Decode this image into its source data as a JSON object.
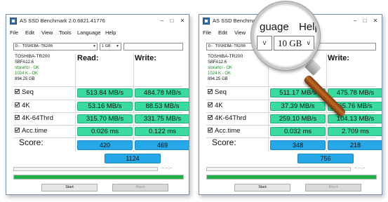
{
  "windows": [
    {
      "title": "AS SSD Benchmark 2.0.6821.41776",
      "menu": [
        "File",
        "Edit",
        "View",
        "Tools",
        "Language",
        "Help"
      ],
      "drive": "D: TOSHIBA-TR200",
      "size": "1 GB",
      "info": {
        "model": "TOSHIBA-TR200",
        "firmware": "SBFA12.6",
        "driver": "storahci - OK",
        "align": "1024 K - OK",
        "capacity": "894.25 GB"
      },
      "headers": {
        "read": "Read:",
        "write": "Write:"
      },
      "rows": [
        {
          "label": "Seq",
          "read": "513.84 MB/s",
          "write": "484.78 MB/s"
        },
        {
          "label": "4K",
          "read": "53.16 MB/s",
          "write": "88.53 MB/s"
        },
        {
          "label": "4K-64Thrd",
          "read": "315.70 MB/s",
          "write": "331.75 MB/s"
        },
        {
          "label": "Acc.time",
          "read": "0.026 ms",
          "write": "0.122 ms"
        }
      ],
      "score_label": "Score:",
      "score": {
        "read": "420",
        "write": "469",
        "total": "1124"
      },
      "time": "--:--:--",
      "progress": 1.0,
      "buttons": {
        "start": "Start",
        "abort": "Abort"
      }
    },
    {
      "title": "AS SSD Benchmark",
      "menu": [
        "File",
        "Edit",
        "View"
      ],
      "drive": "D: TOSHIBA-TR200",
      "size": "",
      "info": {
        "model": "TOSHIBA-TR200",
        "firmware": "SBFA12.6",
        "driver": "storahci - OK",
        "align": "1024 K - OK",
        "capacity": "894.25 GB"
      },
      "headers": {
        "read": "",
        "write": "Write:"
      },
      "rows": [
        {
          "label": "Seq",
          "read": "511.17 MB/s",
          "write": "475.78 MB/s"
        },
        {
          "label": "4K",
          "read": "37.39 MB/s",
          "write": "65.76 MB/s"
        },
        {
          "label": "4K-64Thrd",
          "read": "259.10 MB/s",
          "write": "104.13 MB/s"
        },
        {
          "label": "Acc.time",
          "read": "0.032 ms",
          "write": "2.709 ms"
        }
      ],
      "score_label": "Score:",
      "score": {
        "read": "348",
        "write": "218",
        "total": "756"
      },
      "time": "--:--:--",
      "progress": 1.0,
      "buttons": {
        "start": "Start",
        "abort": "Abort"
      }
    }
  ],
  "magnifier": {
    "menu_left": "guage",
    "menu_right": "Help",
    "size": "10 GB",
    "dropdown_glyph": "v"
  },
  "colors": {
    "value_green": "#3bdba0",
    "score_blue": "#26a7e8",
    "progress_green": "#23b04a"
  }
}
